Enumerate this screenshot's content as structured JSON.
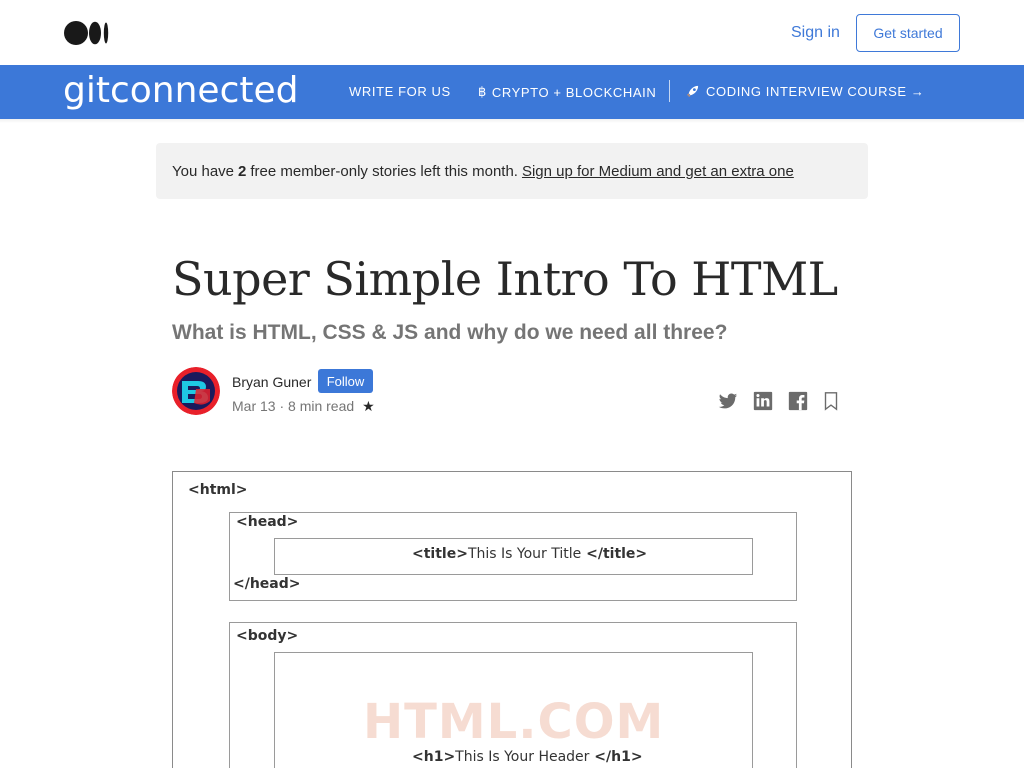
{
  "topbar": {
    "logo_icon": "medium-logo-icon",
    "sign_in": "Sign in",
    "get_started": "Get started"
  },
  "publication": {
    "name": "gitconnected",
    "nav": {
      "write": "WRITE FOR US",
      "crypto": "CRYPTO + BLOCKCHAIN",
      "crypto_icon": "bitcoin-icon",
      "course": "CODING INTERVIEW COURSE →",
      "course_icon": "rocket-icon"
    },
    "colors": {
      "bar": "#3c78d8",
      "text": "#ffffff"
    }
  },
  "banner": {
    "prefix": "You have",
    "count": "2",
    "suffix": "free member-only stories left this month.",
    "link": "Sign up for Medium and get an extra one"
  },
  "article": {
    "title": "Super Simple Intro To HTML",
    "subtitle": "What is HTML, CSS & JS and why do we need all three?",
    "author": "Bryan Guner",
    "follow": "Follow",
    "date_read": "Mar 13 · 8 min read",
    "star": "★"
  },
  "share_icons": [
    "twitter-icon",
    "linkedin-icon",
    "facebook-icon",
    "bookmark-icon"
  ],
  "diagram": {
    "html_open": "<html>",
    "head_open": "<head>",
    "title_open": "<title>",
    "title_text": "This Is Your Title",
    "title_close": "</title>",
    "head_close": "</head>",
    "body_open": "<body>",
    "h1_open": "<h1>",
    "h1_text": "This Is Your Header",
    "h1_close": "</h1>",
    "watermark": "HTML.COM"
  }
}
